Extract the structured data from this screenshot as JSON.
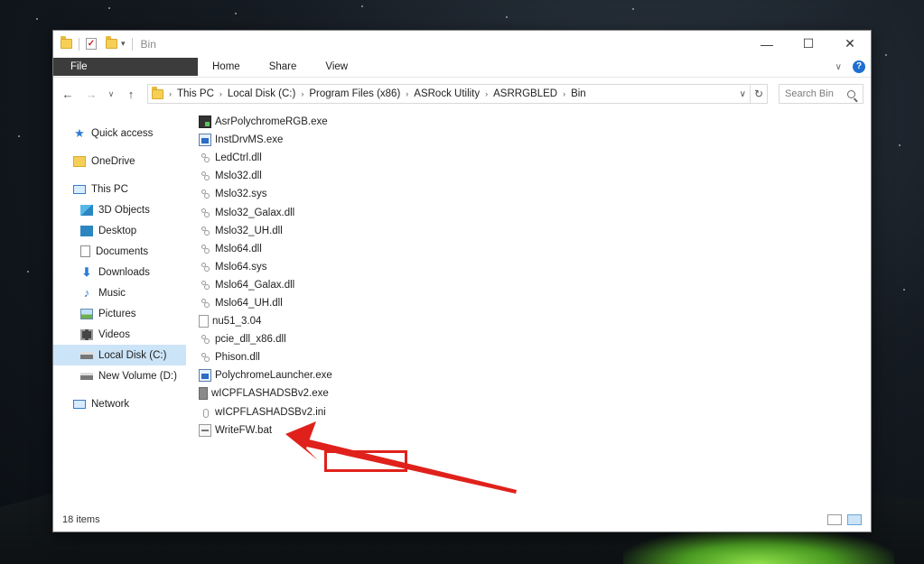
{
  "window": {
    "title": "Bin",
    "minimize": "—",
    "maximize": "☐",
    "close": "✕"
  },
  "ribbon": {
    "tabs": [
      {
        "label": "File"
      },
      {
        "label": "Home"
      },
      {
        "label": "Share"
      },
      {
        "label": "View"
      }
    ],
    "expand_icon": "∨",
    "help": "?"
  },
  "nav": {
    "back": "←",
    "forward": "→",
    "recent": "∨",
    "up": "↑",
    "breadcrumb": [
      "This PC",
      "Local Disk (C:)",
      "Program Files (x86)",
      "ASRock Utility",
      "ASRRGBLED",
      "Bin"
    ],
    "search_placeholder": "Search Bin",
    "refresh": "↻",
    "dropdown": "∨"
  },
  "sidebar": {
    "items": [
      {
        "label": "Quick access",
        "icon": "star-icon"
      },
      {
        "label": "OneDrive",
        "icon": "folder-icon"
      },
      {
        "label": "This PC",
        "icon": "computer-icon"
      },
      {
        "label": "3D Objects",
        "icon": "cube-icon"
      },
      {
        "label": "Desktop",
        "icon": "desktop-icon"
      },
      {
        "label": "Documents",
        "icon": "document-icon"
      },
      {
        "label": "Downloads",
        "icon": "download-icon"
      },
      {
        "label": "Music",
        "icon": "music-icon"
      },
      {
        "label": "Pictures",
        "icon": "picture-icon"
      },
      {
        "label": "Videos",
        "icon": "video-icon"
      },
      {
        "label": "Local Disk (C:)",
        "icon": "disk-icon",
        "selected": true
      },
      {
        "label": "New Volume (D:)",
        "icon": "disk-icon"
      },
      {
        "label": "Network",
        "icon": "network-icon"
      }
    ]
  },
  "files": [
    {
      "name": "AsrPolychromeRGB.exe",
      "icon": "exe-dark"
    },
    {
      "name": "InstDrvMS.exe",
      "icon": "exe-blue"
    },
    {
      "name": "LedCtrl.dll",
      "icon": "dll"
    },
    {
      "name": "Mslo32.dll",
      "icon": "dll"
    },
    {
      "name": "Mslo32.sys",
      "icon": "dll"
    },
    {
      "name": "Mslo32_Galax.dll",
      "icon": "dll"
    },
    {
      "name": "Mslo32_UH.dll",
      "icon": "dll"
    },
    {
      "name": "Mslo64.dll",
      "icon": "dll"
    },
    {
      "name": "Mslo64.sys",
      "icon": "dll"
    },
    {
      "name": "Mslo64_Galax.dll",
      "icon": "dll"
    },
    {
      "name": "Mslo64_UH.dll",
      "icon": "dll"
    },
    {
      "name": "nu51_3.04",
      "icon": "blank"
    },
    {
      "name": "pcie_dll_x86.dll",
      "icon": "dll"
    },
    {
      "name": "Phison.dll",
      "icon": "dll"
    },
    {
      "name": "PolychromeLauncher.exe",
      "icon": "exe-blue"
    },
    {
      "name": "wICPFLASHADSBv2.exe",
      "icon": "exe-gray"
    },
    {
      "name": "wICPFLASHADSBv2.ini",
      "icon": "ini"
    },
    {
      "name": "WriteFW.bat",
      "icon": "bat"
    }
  ],
  "status": {
    "item_count": "18 items"
  },
  "colors": {
    "highlight": "#e0211b",
    "selected": "#cce4f7",
    "file_tab": "#3c3c3c"
  }
}
